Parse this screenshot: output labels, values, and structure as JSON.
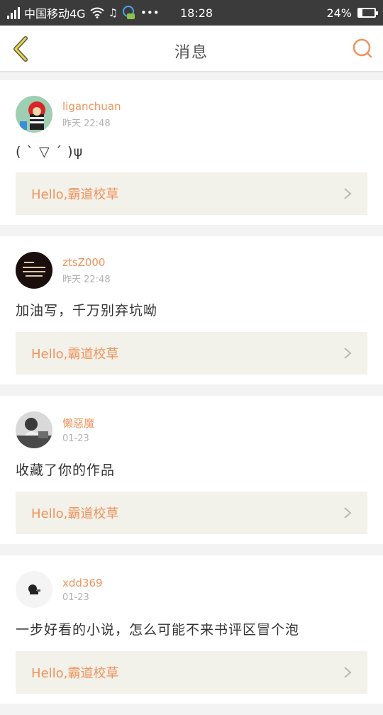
{
  "status_bar": {
    "carrier": "中国移动4G",
    "time": "18:28",
    "battery": "24%",
    "battery_level": 0.24,
    "icons": [
      "signal-icon",
      "wifi-icon",
      "music-icon",
      "message-icon",
      "more-icon",
      "battery-icon"
    ]
  },
  "nav": {
    "title": "消息",
    "back_icon": "back-chevron-icon",
    "search_icon": "search-icon"
  },
  "colors": {
    "accent": "#f0935c",
    "status_bar": "#3b3b3b",
    "book_bg": "#f2f1ea"
  },
  "messages": [
    {
      "username": "liganchuan",
      "time": "昨天 22:48",
      "comment": "( ˋ ▽ ˊ )ψ",
      "book_title": "Hello,霸道校草"
    },
    {
      "username": "ztsZ000",
      "time": "昨天 22:48",
      "comment": "加油写，千万别弃坑呦",
      "book_title": "Hello,霸道校草"
    },
    {
      "username": "懒惡魔",
      "time": "01-23",
      "comment": "收藏了你的作品",
      "book_title": "Hello,霸道校草"
    },
    {
      "username": "xdd369",
      "time": "01-23",
      "comment": "一步好看的小说，怎么可能不来书评区冒个泡",
      "book_title": "Hello,霸道校草"
    }
  ]
}
